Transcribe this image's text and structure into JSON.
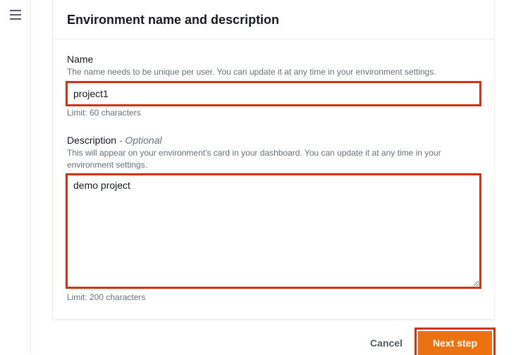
{
  "header": {
    "title": "Environment name and description"
  },
  "fields": {
    "name": {
      "label": "Name",
      "help": "The name needs to be unique per user. You can update it at any time in your environment settings.",
      "value": "project1",
      "limit": "Limit: 60 characters"
    },
    "description": {
      "label": "Description",
      "optional": " - Optional",
      "help": "This will appear on your environment's card in your dashboard. You can update it at any time in your environment settings.",
      "value": "demo project",
      "limit": "Limit: 200 characters"
    }
  },
  "actions": {
    "cancel": "Cancel",
    "next": "Next step"
  }
}
